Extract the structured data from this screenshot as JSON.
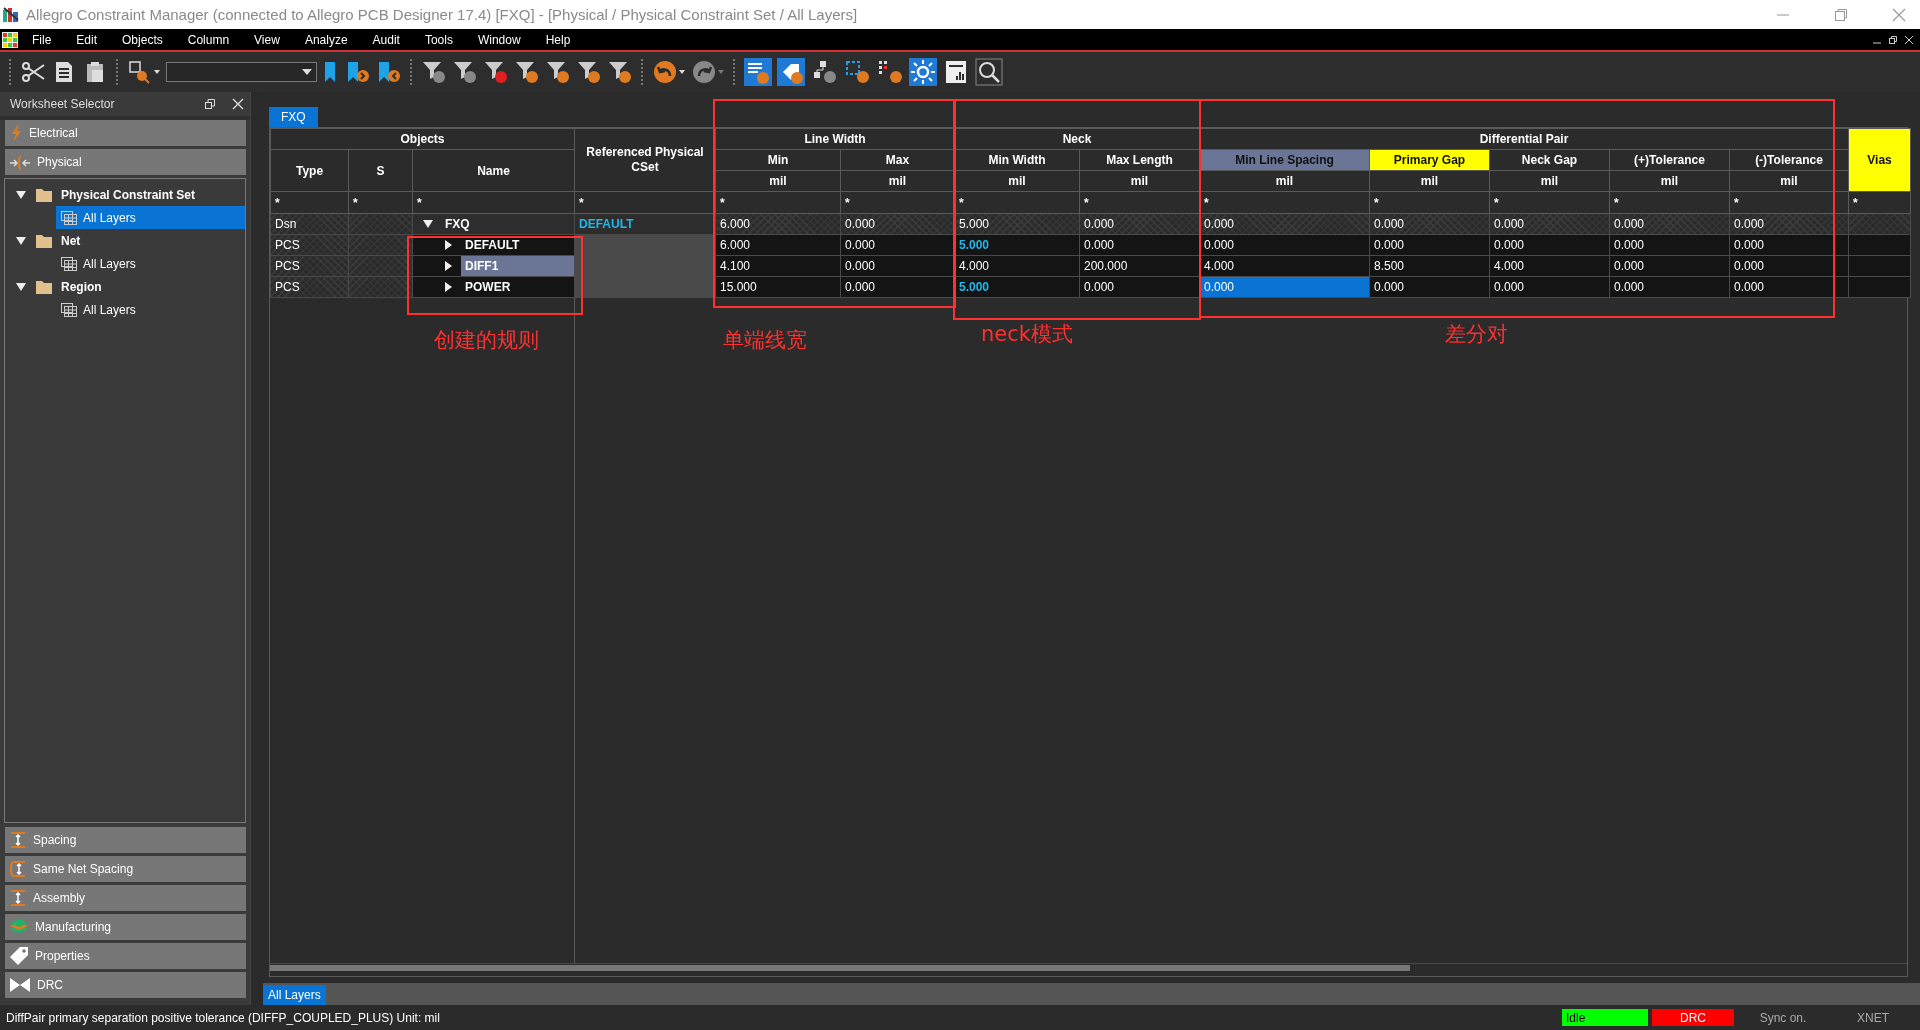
{
  "window": {
    "title": "Allegro Constraint Manager (connected to Allegro PCB Designer 17.4) [FXQ] - [Physical / Physical Constraint Set / All Layers]"
  },
  "menu": [
    "File",
    "Edit",
    "Objects",
    "Column",
    "View",
    "Analyze",
    "Audit",
    "Tools",
    "Window",
    "Help"
  ],
  "worksheet_selector": {
    "title": "Worksheet Selector",
    "sections_top": [
      {
        "label": "Electrical",
        "kind": "electrical"
      },
      {
        "label": "Physical",
        "kind": "physical"
      }
    ],
    "tree": [
      {
        "label": "Physical Constraint Set",
        "expanded": true,
        "children": [
          {
            "label": "All Layers",
            "selected": true
          }
        ]
      },
      {
        "label": "Net",
        "expanded": true,
        "children": [
          {
            "label": "All Layers",
            "selected": false
          }
        ]
      },
      {
        "label": "Region",
        "expanded": true,
        "children": [
          {
            "label": "All Layers",
            "selected": false
          }
        ]
      }
    ],
    "sections_bottom": [
      {
        "label": "Spacing",
        "kind": "spacing"
      },
      {
        "label": "Same Net Spacing",
        "kind": "samenet"
      },
      {
        "label": "Assembly",
        "kind": "spacing"
      },
      {
        "label": "Manufacturing",
        "kind": "layers"
      },
      {
        "label": "Properties",
        "kind": "tag"
      },
      {
        "label": "DRC",
        "kind": "bowtie"
      }
    ]
  },
  "worksheet_tabs": [
    {
      "label": "FXQ",
      "selected": true
    }
  ],
  "table": {
    "groups": [
      {
        "label": "Objects",
        "columns": [
          {
            "name": "Type",
            "filter": "*",
            "selected": false,
            "highlighted": false
          },
          {
            "name": "S",
            "filter": "*",
            "selected": false,
            "highlighted": false
          },
          {
            "name": "Name",
            "filter": "*",
            "selected": false,
            "highlighted": false
          }
        ]
      },
      {
        "columns": [
          {
            "name": "Referenced Physical CSet",
            "filter": "*",
            "selected": false,
            "highlighted": false
          }
        ]
      },
      {
        "label": "Line Width",
        "columns": [
          {
            "name": "Min",
            "unit": "mil",
            "filter": "*",
            "selected": false,
            "highlighted": false
          },
          {
            "name": "Max",
            "unit": "mil",
            "filter": "*",
            "selected": false,
            "highlighted": false
          }
        ]
      },
      {
        "label": "Neck",
        "columns": [
          {
            "name": "Min Width",
            "unit": "mil",
            "filter": "*",
            "selected": false,
            "highlighted": false
          },
          {
            "name": "Max Length",
            "unit": "mil",
            "filter": "*",
            "selected": false,
            "highlighted": false
          }
        ]
      },
      {
        "label": "Differential Pair",
        "columns": [
          {
            "name": "Min Line Spacing",
            "unit": "mil",
            "filter": "*",
            "selected": true,
            "highlighted": false
          },
          {
            "name": "Primary Gap",
            "unit": "mil",
            "filter": "*",
            "selected": false,
            "highlighted": true
          },
          {
            "name": "Neck Gap",
            "unit": "mil",
            "filter": "*",
            "selected": false,
            "highlighted": false
          },
          {
            "name": "(+)Tolerance",
            "unit": "mil",
            "filter": "*",
            "selected": false,
            "highlighted": false
          },
          {
            "name": "(-)Tolerance",
            "unit": "mil",
            "filter": "*",
            "selected": false,
            "highlighted": false
          }
        ]
      },
      {
        "columns": [
          {
            "name": "Vias",
            "filter": "*",
            "selected": false,
            "highlighted": true
          }
        ]
      }
    ],
    "rows": [
      {
        "kind": "design",
        "type": "Dsn",
        "name": "FXQ",
        "expanded": true,
        "name_selected": false,
        "ref": "DEFAULT",
        "values": [
          {
            "text": "6.000",
            "accent": false,
            "selected": false
          },
          {
            "text": "0.000",
            "accent": false,
            "selected": false
          },
          {
            "text": "5.000",
            "accent": false,
            "selected": false
          },
          {
            "text": "0.000",
            "accent": false,
            "selected": false
          },
          {
            "text": "0.000",
            "accent": false,
            "selected": false
          },
          {
            "text": "0.000",
            "accent": false,
            "selected": false
          },
          {
            "text": "0.000",
            "accent": false,
            "selected": false
          },
          {
            "text": "0.000",
            "accent": false,
            "selected": false
          },
          {
            "text": "0.000",
            "accent": false,
            "selected": false
          }
        ]
      },
      {
        "kind": "cset",
        "type": "PCS",
        "name": "DEFAULT",
        "expanded": false,
        "name_selected": false,
        "values": [
          {
            "text": "6.000",
            "accent": false,
            "selected": false
          },
          {
            "text": "0.000",
            "accent": false,
            "selected": false
          },
          {
            "text": "5.000",
            "accent": true,
            "selected": false
          },
          {
            "text": "0.000",
            "accent": false,
            "selected": false
          },
          {
            "text": "0.000",
            "accent": false,
            "selected": false
          },
          {
            "text": "0.000",
            "accent": false,
            "selected": false
          },
          {
            "text": "0.000",
            "accent": false,
            "selected": false
          },
          {
            "text": "0.000",
            "accent": false,
            "selected": false
          },
          {
            "text": "0.000",
            "accent": false,
            "selected": false
          }
        ]
      },
      {
        "kind": "cset",
        "type": "PCS",
        "name": "DIFF1",
        "expanded": false,
        "name_selected": true,
        "values": [
          {
            "text": "4.100",
            "accent": false,
            "selected": false
          },
          {
            "text": "0.000",
            "accent": false,
            "selected": false
          },
          {
            "text": "4.000",
            "accent": false,
            "selected": false
          },
          {
            "text": "200.000",
            "accent": false,
            "selected": false
          },
          {
            "text": "4.000",
            "accent": false,
            "selected": false
          },
          {
            "text": "8.500",
            "accent": false,
            "selected": false
          },
          {
            "text": "4.000",
            "accent": false,
            "selected": false
          },
          {
            "text": "0.000",
            "accent": false,
            "selected": false
          },
          {
            "text": "0.000",
            "accent": false,
            "selected": false
          }
        ]
      },
      {
        "kind": "cset",
        "type": "PCS",
        "name": "POWER",
        "expanded": false,
        "name_selected": false,
        "values": [
          {
            "text": "15.000",
            "accent": false,
            "selected": false
          },
          {
            "text": "0.000",
            "accent": false,
            "selected": false
          },
          {
            "text": "5.000",
            "accent": true,
            "selected": false
          },
          {
            "text": "0.000",
            "accent": false,
            "selected": false
          },
          {
            "text": "0.000",
            "accent": false,
            "selected": true
          },
          {
            "text": "0.000",
            "accent": false,
            "selected": false
          },
          {
            "text": "0.000",
            "accent": false,
            "selected": false
          },
          {
            "text": "0.000",
            "accent": false,
            "selected": false
          },
          {
            "text": "0.000",
            "accent": false,
            "selected": false
          }
        ]
      }
    ]
  },
  "annotations": [
    {
      "label": "创建的规则"
    },
    {
      "label": "单端线宽"
    },
    {
      "label": "neck模式"
    },
    {
      "label": "差分对"
    }
  ],
  "bottom_tabs": [
    {
      "label": "All Layers",
      "selected": true
    }
  ],
  "status_bar": {
    "message": "DiffPair primary separation positive tolerance (DIFFP_COUPLED_PLUS) Unit: mil",
    "indicators": [
      {
        "label": "Idle",
        "color": "#00ff00"
      },
      {
        "label": "DRC",
        "color": "#ff0000"
      },
      {
        "label": "Sync on.",
        "color": "#2b2b2b"
      },
      {
        "label": "XNET",
        "color": "#2b2b2b"
      }
    ]
  }
}
